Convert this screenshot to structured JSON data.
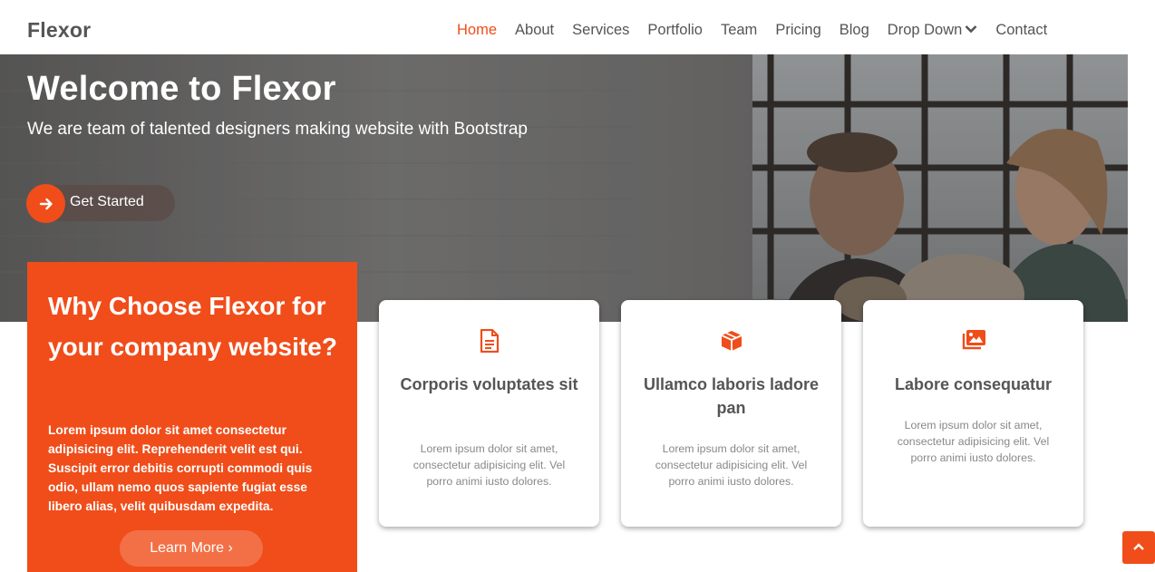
{
  "header": {
    "logo": "Flexor",
    "nav": [
      {
        "label": "Home",
        "active": true
      },
      {
        "label": "About"
      },
      {
        "label": "Services"
      },
      {
        "label": "Portfolio"
      },
      {
        "label": "Team"
      },
      {
        "label": "Pricing"
      },
      {
        "label": "Blog"
      },
      {
        "label": "Drop Down",
        "icon": "chevron-down-icon"
      },
      {
        "label": "Contact"
      }
    ]
  },
  "hero": {
    "title": "Welcome to Flexor",
    "subtitle": "We are team of talented designers making website with Bootstrap",
    "cta_label": "Get Started",
    "cta_icon": "arrow-right-icon"
  },
  "why": {
    "title": "Why Choose Flexor for your company website?",
    "text": "Lorem ipsum dolor sit amet consectetur adipisicing elit. Reprehenderit velit est qui. Suscipit error debitis corrupti commodi quis odio, ullam nemo quos sapiente fugiat esse libero alias, velit quibusdam expedita.",
    "button_label": "Learn More ›"
  },
  "cards": [
    {
      "icon": "document-icon",
      "title": "Corporis voluptates sit",
      "text": "Lorem ipsum dolor sit amet, consectetur adipisicing elit. Vel porro animi iusto dolores."
    },
    {
      "icon": "cube-icon",
      "title": "Ullamco laboris ladore pan",
      "text": "Lorem ipsum dolor sit amet, consectetur adipisicing elit. Vel porro animi iusto dolores."
    },
    {
      "icon": "images-icon",
      "title": "Labore consequatur",
      "text": "Lorem ipsum dolor sit amet, consectetur adipisicing elit. Vel porro animi iusto dolores."
    }
  ],
  "back_to_top_icon": "chevron-up-icon",
  "colors": {
    "accent": "#f04d1a",
    "text": "#555555",
    "muted": "#888888"
  }
}
